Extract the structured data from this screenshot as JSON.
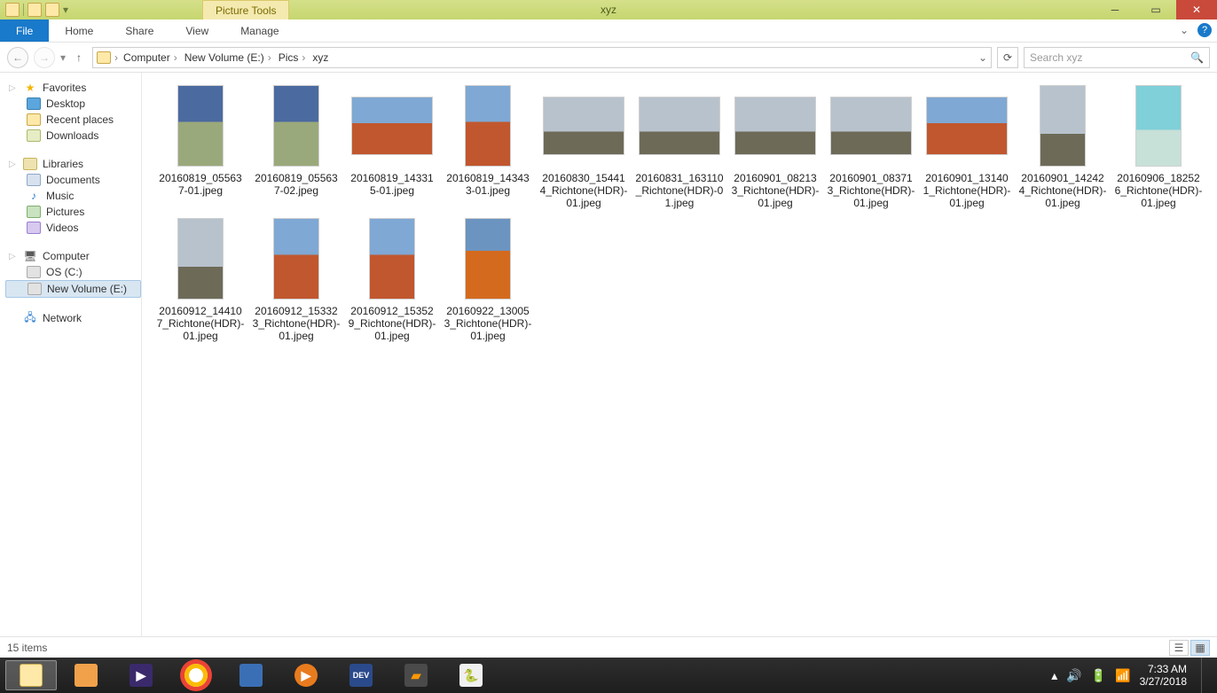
{
  "title": "xyz",
  "pictureTools": "Picture Tools",
  "ribbon": {
    "file": "File",
    "home": "Home",
    "share": "Share",
    "view": "View",
    "manage": "Manage"
  },
  "breadcrumbs": [
    "Computer",
    "New Volume (E:)",
    "Pics",
    "xyz"
  ],
  "searchPlaceholder": "Search xyz",
  "sidebar": {
    "favorites": {
      "label": "Favorites",
      "items": [
        "Desktop",
        "Recent places",
        "Downloads"
      ]
    },
    "libraries": {
      "label": "Libraries",
      "items": [
        "Documents",
        "Music",
        "Pictures",
        "Videos"
      ]
    },
    "computer": {
      "label": "Computer",
      "items": [
        "OS (C:)",
        "New Volume (E:)"
      ]
    },
    "network": {
      "label": "Network"
    }
  },
  "files": [
    {
      "name": "20160819_055637-01.jpeg",
      "orient": "portrait",
      "tone": "sky"
    },
    {
      "name": "20160819_055637-02.jpeg",
      "orient": "portrait",
      "tone": "sky"
    },
    {
      "name": "20160819_143315-01.jpeg",
      "orient": "landscape",
      "tone": "redb"
    },
    {
      "name": "20160819_143433-01.jpeg",
      "orient": "portrait",
      "tone": "redb"
    },
    {
      "name": "20160830_154414_Richtone(HDR)-01.jpeg",
      "orient": "landscape",
      "tone": "cloud"
    },
    {
      "name": "20160831_163110_Richtone(HDR)-01.jpeg",
      "orient": "landscape",
      "tone": "cloud"
    },
    {
      "name": "20160901_082133_Richtone(HDR)-01.jpeg",
      "orient": "landscape",
      "tone": "cloud"
    },
    {
      "name": "20160901_083713_Richtone(HDR)-01.jpeg",
      "orient": "landscape",
      "tone": "cloud"
    },
    {
      "name": "20160901_131401_Richtone(HDR)-01.jpeg",
      "orient": "landscape",
      "tone": "redb"
    },
    {
      "name": "20160901_142424_Richtone(HDR)-01.jpeg",
      "orient": "portrait",
      "tone": "cloud"
    },
    {
      "name": "20160906_182526_Richtone(HDR)-01.jpeg",
      "orient": "portrait",
      "tone": "teal"
    },
    {
      "name": "20160912_144107_Richtone(HDR)-01.jpeg",
      "orient": "portrait",
      "tone": "cloud"
    },
    {
      "name": "20160912_153323_Richtone(HDR)-01.jpeg",
      "orient": "portrait",
      "tone": "redb"
    },
    {
      "name": "20160912_153529_Richtone(HDR)-01.jpeg",
      "orient": "portrait",
      "tone": "redb"
    },
    {
      "name": "20160922_130053_Richtone(HDR)-01.jpeg",
      "orient": "portrait",
      "tone": "orng"
    }
  ],
  "status": "15 items",
  "clock": {
    "time": "7:33 AM",
    "date": "3/27/2018"
  }
}
